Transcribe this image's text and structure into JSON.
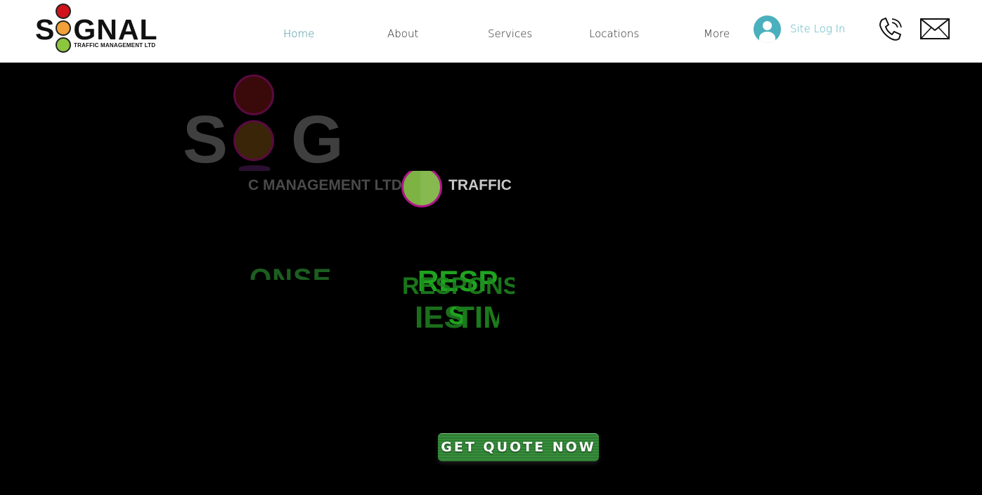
{
  "brand": {
    "word_left": "S",
    "word_right": "GNAL",
    "tagline": "TRAFFIC MANAGEMENT LTD",
    "light_colors": [
      "#d0121b",
      "#f0a13a",
      "#8cc63f"
    ]
  },
  "nav": {
    "items": [
      {
        "label": "Home",
        "active": true
      },
      {
        "label": "About",
        "active": false
      },
      {
        "label": "Services",
        "active": false
      },
      {
        "label": "Locations",
        "active": false
      },
      {
        "label": "More",
        "active": false
      }
    ]
  },
  "login": {
    "label": "Site Log In",
    "icon": "user-avatar-icon"
  },
  "contact_icons": [
    "phone-icon",
    "mail-icon"
  ],
  "hero": {
    "ghost_word_left": "S",
    "ghost_word_right": "G",
    "ghost_tagline_left": "C MANAGEMENT LTD",
    "ghost_tagline_right": "TRAFFIC",
    "fragments": {
      "f1": "ONSE",
      "f2": "RESP",
      "f3": "RESPONSE",
      "f4": "S",
      "f5": "IES",
      "f6": "TIM"
    },
    "cta_label": "GET QUOTE NOW",
    "accent": "#2e7d32"
  }
}
